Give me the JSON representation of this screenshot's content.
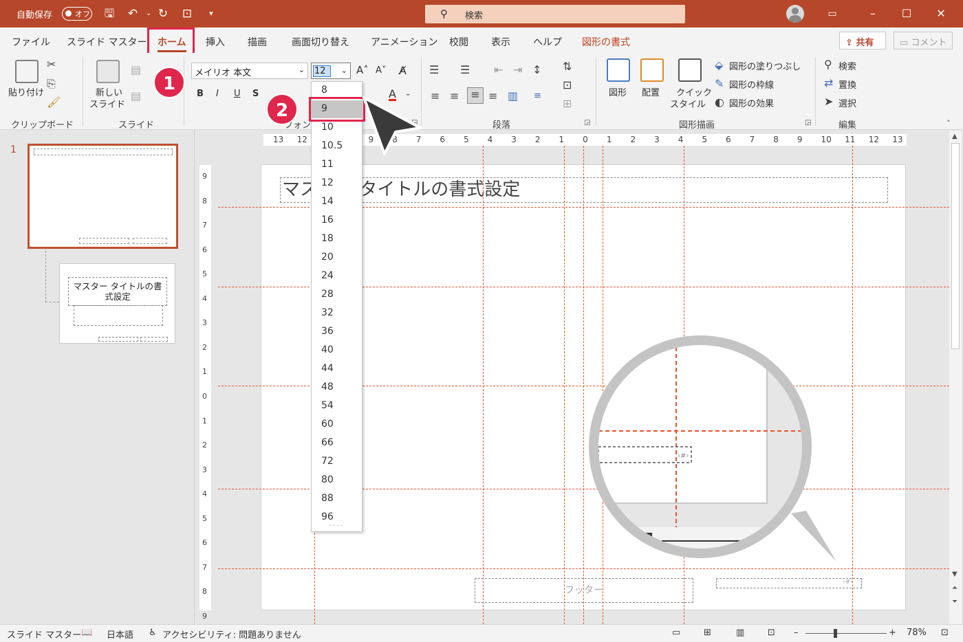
{
  "titlebar": {
    "autosave_label": "自動保存",
    "autosave_state": "オフ",
    "search_placeholder": "検索",
    "accent_color": "#b7472a"
  },
  "tabs": [
    "ファイル",
    "スライド マスター",
    "ホーム",
    "挿入",
    "描画",
    "画面切り替え",
    "アニメーション",
    "校閲",
    "表示",
    "ヘルプ",
    "図形の書式"
  ],
  "active_tab": "ホーム",
  "share_label": "共有",
  "comment_label": "コメント",
  "ribbon": {
    "clipboard": {
      "paste_label": "貼り付け",
      "group_label": "クリップボード"
    },
    "slide": {
      "new_slide_label_1": "新しい",
      "new_slide_label_2": "スライド",
      "group_label": "スライド"
    },
    "font": {
      "font_name": "メイリオ 本文",
      "font_size": "12",
      "group_label": "フォント"
    },
    "paragraph": {
      "group_label": "段落"
    },
    "drawing": {
      "shape_label": "図形",
      "arrange_label": "配置",
      "quick_style_1": "クイック",
      "quick_style_2": "スタイル",
      "fill_label": "図形の塗りつぶし",
      "outline_label": "図形の枠線",
      "effect_label": "図形の効果",
      "group_label": "図形描画"
    },
    "editing": {
      "find_label": "検索",
      "replace_label": "置換",
      "select_label": "選択",
      "group_label": "編集"
    }
  },
  "font_size_options": [
    "8",
    "9",
    "10",
    "10.5",
    "11",
    "12",
    "14",
    "16",
    "18",
    "20",
    "24",
    "28",
    "32",
    "36",
    "40",
    "44",
    "48",
    "54",
    "60",
    "66",
    "72",
    "80",
    "88",
    "96"
  ],
  "selected_option": "9",
  "badges": {
    "step1": "1",
    "step2": "2"
  },
  "thumbnails": {
    "slide_number": "1",
    "layout_title_1": "マスター タイトルの書",
    "layout_title_2": "式設定"
  },
  "slide": {
    "title_text": "マスター タイトルの書式設定",
    "footer_text": "フッター"
  },
  "hruler_labels": [
    "13",
    "12",
    "11",
    "10",
    "9",
    "8",
    "7",
    "6",
    "5",
    "4",
    "3",
    "2",
    "1",
    "0",
    "1",
    "2",
    "3",
    "4",
    "5",
    "6",
    "7",
    "8",
    "9",
    "10",
    "11",
    "12",
    "13"
  ],
  "vruler_labels": [
    "9",
    "8",
    "7",
    "6",
    "5",
    "4",
    "3",
    "2",
    "1",
    "0",
    "1",
    "2",
    "3",
    "4",
    "5",
    "6",
    "7",
    "8",
    "9"
  ],
  "statusbar": {
    "view_name": "スライド マスター",
    "language": "日本語",
    "accessibility": "アクセシビリティ: 問題ありません",
    "zoom": "78%"
  }
}
